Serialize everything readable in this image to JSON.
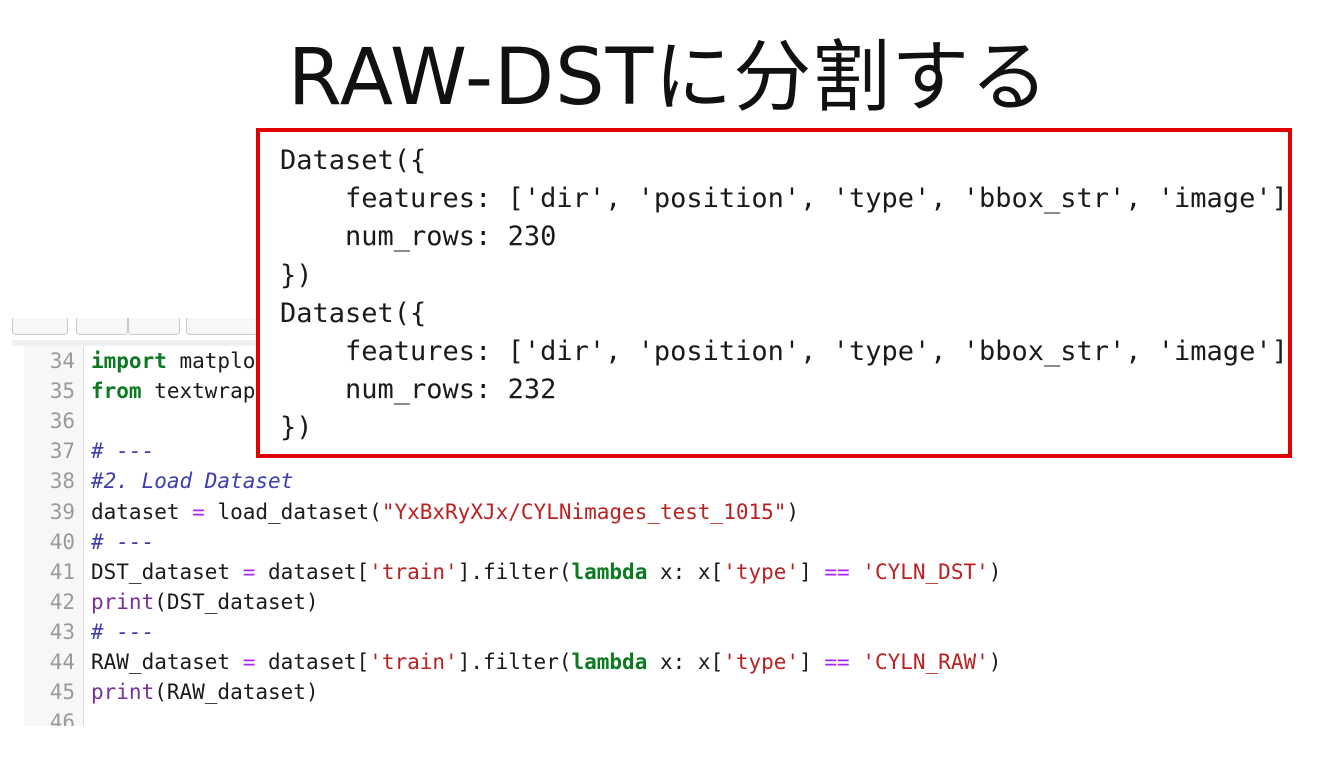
{
  "slide": {
    "title": "RAW-DSTに分割する"
  },
  "editor": {
    "lines": [
      {
        "num": "34",
        "segments": [
          {
            "t": "import",
            "c": "kw"
          },
          {
            "t": " matplo",
            "c": ""
          }
        ]
      },
      {
        "num": "35",
        "segments": [
          {
            "t": "from",
            "c": "kw"
          },
          {
            "t": " textwrap",
            "c": ""
          }
        ]
      },
      {
        "num": "36",
        "segments": []
      },
      {
        "num": "37",
        "segments": [
          {
            "t": "# ---",
            "c": "cmt"
          }
        ]
      },
      {
        "num": "38",
        "segments": [
          {
            "t": "#2. Load Dataset",
            "c": "cmt"
          }
        ]
      },
      {
        "num": "39",
        "segments": [
          {
            "t": "dataset ",
            "c": ""
          },
          {
            "t": "=",
            "c": "op"
          },
          {
            "t": " load_dataset(",
            "c": ""
          },
          {
            "t": "\"YxBxRyXJx/CYLNimages_test_1015\"",
            "c": "str"
          },
          {
            "t": ")",
            "c": ""
          }
        ]
      },
      {
        "num": "40",
        "segments": [
          {
            "t": "# ---",
            "c": "cmt"
          }
        ]
      },
      {
        "num": "41",
        "segments": [
          {
            "t": "DST_dataset ",
            "c": ""
          },
          {
            "t": "=",
            "c": "op"
          },
          {
            "t": " dataset[",
            "c": ""
          },
          {
            "t": "'train'",
            "c": "str"
          },
          {
            "t": "].filter(",
            "c": ""
          },
          {
            "t": "lambda",
            "c": "kw"
          },
          {
            "t": " x: x[",
            "c": ""
          },
          {
            "t": "'type'",
            "c": "str"
          },
          {
            "t": "] ",
            "c": ""
          },
          {
            "t": "==",
            "c": "op"
          },
          {
            "t": " ",
            "c": ""
          },
          {
            "t": "'CYLN_DST'",
            "c": "str"
          },
          {
            "t": ")",
            "c": ""
          }
        ]
      },
      {
        "num": "42",
        "segments": [
          {
            "t": "print",
            "c": "builtin"
          },
          {
            "t": "(DST_dataset)",
            "c": ""
          }
        ]
      },
      {
        "num": "43",
        "segments": [
          {
            "t": "# ---",
            "c": "cmt"
          }
        ]
      },
      {
        "num": "44",
        "segments": [
          {
            "t": "RAW_dataset ",
            "c": ""
          },
          {
            "t": "=",
            "c": "op"
          },
          {
            "t": " dataset[",
            "c": ""
          },
          {
            "t": "'train'",
            "c": "str"
          },
          {
            "t": "].filter(",
            "c": ""
          },
          {
            "t": "lambda",
            "c": "kw"
          },
          {
            "t": " x: x[",
            "c": ""
          },
          {
            "t": "'type'",
            "c": "str"
          },
          {
            "t": "] ",
            "c": ""
          },
          {
            "t": "==",
            "c": "op"
          },
          {
            "t": " ",
            "c": ""
          },
          {
            "t": "'CYLN_RAW'",
            "c": "str"
          },
          {
            "t": ")",
            "c": ""
          }
        ]
      },
      {
        "num": "45",
        "segments": [
          {
            "t": "print",
            "c": "builtin"
          },
          {
            "t": "(RAW_dataset)",
            "c": ""
          }
        ]
      },
      {
        "num": "46",
        "segments": []
      }
    ]
  },
  "output": {
    "lines": [
      "Dataset({",
      "    features: ['dir', 'position', 'type', 'bbox_str', 'image'],",
      "    num_rows: 230",
      "})",
      "Dataset({",
      "    features: ['dir', 'position', 'type', 'bbox_str', 'image'],",
      "    num_rows: 232",
      "})"
    ]
  },
  "colors": {
    "highlight_border": "#e00000",
    "keyword": "#0b7a20",
    "comment": "#3d3dae",
    "string": "#ba2121",
    "builtin": "#7a2f9c",
    "operator": "#aa22ff"
  }
}
